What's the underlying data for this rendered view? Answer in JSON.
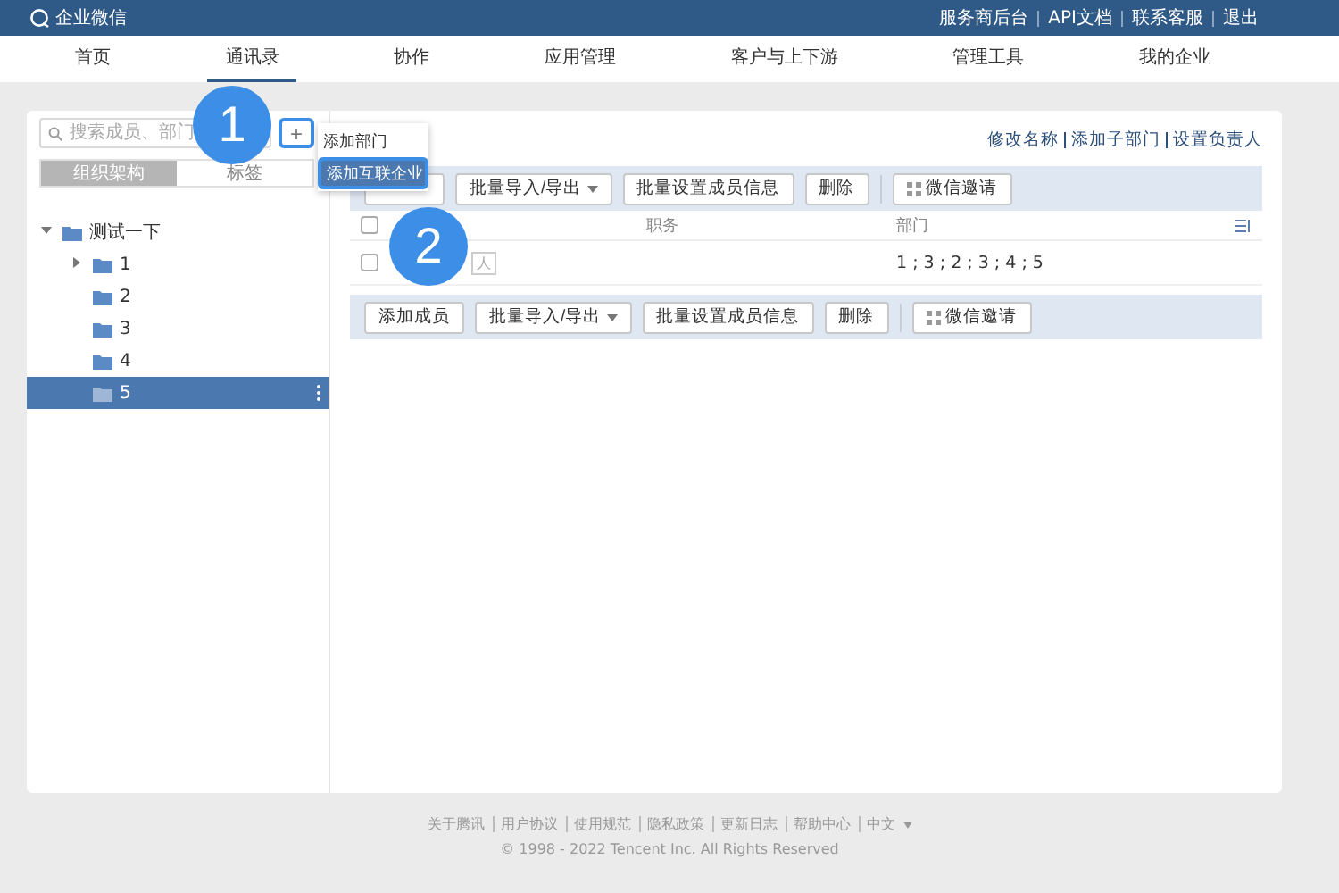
{
  "header": {
    "logo": "企业微信",
    "links": [
      "服务商后台",
      "API文档",
      "联系客服",
      "退出"
    ]
  },
  "nav": [
    {
      "label": "首页",
      "selected": false
    },
    {
      "label": "通讯录",
      "selected": true
    },
    {
      "label": "协作",
      "selected": false
    },
    {
      "label": "应用管理",
      "selected": false
    },
    {
      "label": "客户与上下游",
      "selected": false
    },
    {
      "label": "管理工具",
      "selected": false
    },
    {
      "label": "我的企业",
      "selected": false
    }
  ],
  "sidebar": {
    "search": {
      "placeholder": "搜索成员、部门"
    },
    "plus": "+",
    "segments": [
      {
        "label": "组织架构",
        "selected": true
      },
      {
        "label": "标签",
        "selected": false
      }
    ],
    "tree": [
      {
        "label": "测试一下",
        "expanded": true,
        "selected": false,
        "children": [
          {
            "label": "1",
            "expanded": false,
            "selected": false
          },
          {
            "label": "2",
            "selected": false
          },
          {
            "label": "3",
            "selected": false
          },
          {
            "label": "4",
            "selected": false
          },
          {
            "label": "5",
            "selected": true
          }
        ]
      }
    ]
  },
  "dropdown": [
    {
      "label": "添加部门",
      "selected": false
    },
    {
      "label": "添加互联企业",
      "selected": true
    }
  ],
  "dept_links": [
    "修改名称",
    "添加子部门",
    "设置负责人"
  ],
  "toolbar_top": [
    {
      "kind": "plain"
    },
    {
      "label": "批量导入/导出",
      "kind": "menu"
    },
    {
      "label": "批量设置成员信息",
      "kind": "plain"
    },
    {
      "label": "删除",
      "kind": "plain"
    },
    {
      "label": "微信邀请",
      "kind": "qr"
    }
  ],
  "toolbar_bottom": [
    {
      "label": "添加成员",
      "kind": "plain"
    },
    {
      "label": "批量导入/导出",
      "kind": "menu"
    },
    {
      "label": "批量设置成员信息",
      "kind": "plain"
    },
    {
      "label": "删除",
      "kind": "plain"
    },
    {
      "label": "微信邀请",
      "kind": "qr"
    }
  ],
  "table": {
    "select_all_checked": false,
    "columns": [
      "",
      "职务",
      "部门"
    ],
    "rows": [
      {
        "checked": false,
        "tag": "人",
        "title": "",
        "department": "1 ; 3 ; 2 ; 3 ; 4 ; 5"
      }
    ]
  },
  "callouts": [
    "1",
    "2"
  ],
  "footer": {
    "links": [
      "关于腾讯",
      "用户协议",
      "使用规范",
      "隐私政策",
      "更新日志",
      "帮助中心"
    ],
    "language": "中文",
    "copyright": "© 1998 - 2022 Tencent Inc. All Rights Reserved"
  }
}
